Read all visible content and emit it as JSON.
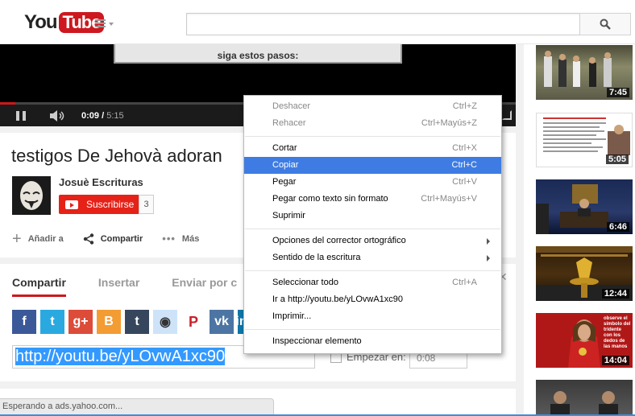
{
  "masthead": {
    "logo_you": "You",
    "logo_tube": "Tube",
    "search_placeholder": ""
  },
  "player": {
    "slide_text": "siga estos pasos:",
    "current_time": "0:09",
    "duration": "5:15",
    "progress_fraction": 0.03
  },
  "video": {
    "title": "testigos De Jehovà adoran",
    "channel": "Josuè Escrituras",
    "subscribe_label": "Suscribirse",
    "subscriber_count": "3",
    "actions": {
      "add": "Añadir a",
      "share": "Compartir",
      "more": "Más"
    }
  },
  "share": {
    "tabs": [
      "Compartir",
      "Insertar",
      "Enviar por c"
    ],
    "socials": [
      {
        "name": "facebook",
        "glyph": "f",
        "color": "#3b5998"
      },
      {
        "name": "twitter",
        "glyph": "t",
        "color": "#2aa9e0"
      },
      {
        "name": "google-plus",
        "glyph": "g+",
        "color": "#dd4b39"
      },
      {
        "name": "blogger",
        "glyph": "B",
        "color": "#f39c33"
      },
      {
        "name": "tumblr",
        "glyph": "t",
        "color": "#36465d"
      },
      {
        "name": "reddit",
        "glyph": "◉",
        "color": "#cee3f8"
      },
      {
        "name": "pinterest",
        "glyph": "P",
        "color": "#ffffff"
      },
      {
        "name": "vk",
        "glyph": "vk",
        "color": "#4c75a3"
      },
      {
        "name": "linkedin",
        "glyph": "in",
        "color": "#0e76a8"
      }
    ],
    "url": "http://youtu.be/yLOvwA1xc90",
    "start_label": "Empezar en:",
    "start_value": "0:08"
  },
  "status": {
    "text": "Esperando a ads.yahoo.com..."
  },
  "sidebar": {
    "thumbnails": [
      {
        "duration": "7:45"
      },
      {
        "duration": "5:05"
      },
      {
        "duration": "6:46"
      },
      {
        "duration": "12:44"
      },
      {
        "duration": "14:04"
      },
      {
        "duration": ""
      }
    ],
    "thumb5_caption": "observe el símbolo del tridente con los dedos de las manos"
  },
  "context_menu": {
    "groups": [
      [
        {
          "label": "Deshacer",
          "shortcut": "Ctrl+Z",
          "disabled": true
        },
        {
          "label": "Rehacer",
          "shortcut": "Ctrl+Mayús+Z",
          "disabled": true
        }
      ],
      [
        {
          "label": "Cortar",
          "shortcut": "Ctrl+X",
          "disabled": false
        },
        {
          "label": "Copiar",
          "shortcut": "Ctrl+C",
          "disabled": false,
          "highlighted": true
        },
        {
          "label": "Pegar",
          "shortcut": "Ctrl+V",
          "disabled": false
        },
        {
          "label": "Pegar como texto sin formato",
          "shortcut": "Ctrl+Mayús+V",
          "disabled": false
        },
        {
          "label": "Suprimir",
          "shortcut": "",
          "disabled": false
        }
      ],
      [
        {
          "label": "Opciones del corrector ortográfico",
          "shortcut": "",
          "submenu": true
        },
        {
          "label": "Sentido de la escritura",
          "shortcut": "",
          "submenu": true
        }
      ],
      [
        {
          "label": "Seleccionar todo",
          "shortcut": "Ctrl+A"
        },
        {
          "label": "Ir a http://youtu.be/yLOvwA1xc90",
          "shortcut": ""
        },
        {
          "label": "Imprimir...",
          "shortcut": ""
        }
      ],
      [
        {
          "label": "Inspeccionar elemento",
          "shortcut": ""
        }
      ]
    ]
  }
}
